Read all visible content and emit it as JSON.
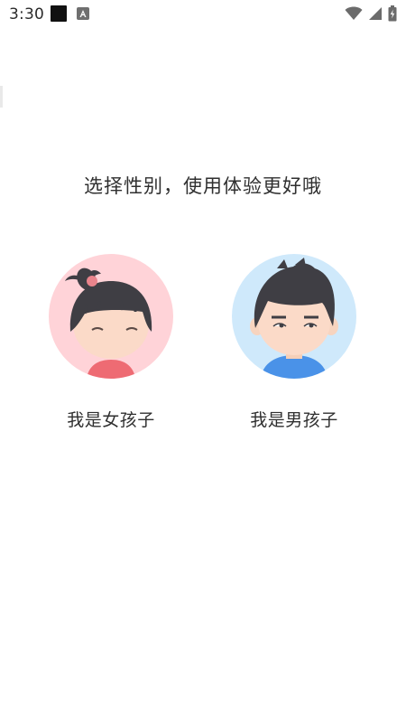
{
  "status_bar": {
    "time": "3:30",
    "icons": [
      "notification-square-icon",
      "notification-app-icon",
      "wifi-icon",
      "cellular-signal-icon",
      "battery-icon"
    ]
  },
  "main": {
    "headline": "选择性别，使用体验更好哦",
    "options": [
      {
        "label": "我是女孩子",
        "avatar": "girl-avatar-icon",
        "bg_color": "#ffd3d8"
      },
      {
        "label": "我是男孩子",
        "avatar": "boy-avatar-icon",
        "bg_color": "#cfe9fb"
      }
    ]
  }
}
